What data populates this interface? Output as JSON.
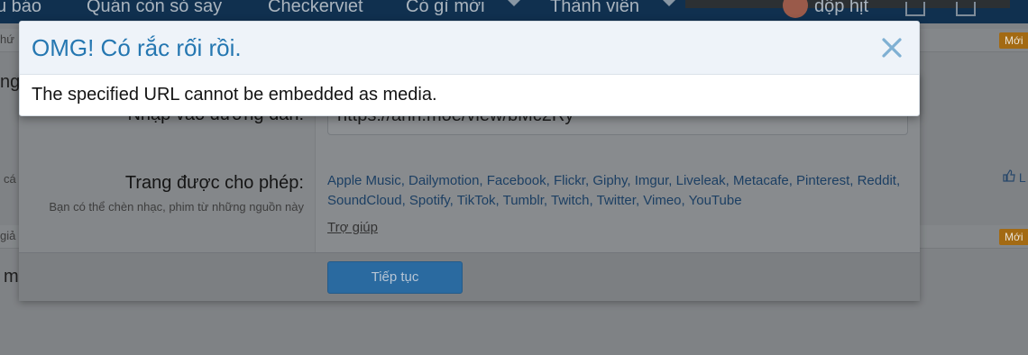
{
  "nav": {
    "items": [
      "u báo",
      "Quán còn sỏ say",
      "Checkerviet",
      "Có gì mới",
      "Thành viên"
    ],
    "user": "dộp hịt"
  },
  "background": {
    "side_texts": [
      "hứ",
      "ng",
      "cá",
      "giả",
      "m"
    ],
    "badges": [
      "Mới",
      "Mới"
    ],
    "like": "L"
  },
  "media_dialog": {
    "url_label": "Nhập vào đường dẫn:",
    "url_value": "https://anh.moe/view/bMc2Ry",
    "sites_label": "Trang được cho phép:",
    "sites_explain": "Bạn có thể chèn nhạc, phim từ những nguồn này",
    "sites": [
      "Apple Music",
      "Dailymotion",
      "Facebook",
      "Flickr",
      "Giphy",
      "Imgur",
      "Liveleak",
      "Metacafe",
      "Pinterest",
      "Reddit",
      "SoundCloud",
      "Spotify",
      "TikTok",
      "Tumblr",
      "Twitch",
      "Twitter",
      "Vimeo",
      "YouTube"
    ],
    "help_link": "Trợ giúp",
    "continue_label": "Tiếp tục"
  },
  "error": {
    "title": "OMG! Có rắc rối rồi.",
    "message": "The specified URL cannot be embedded as media."
  },
  "colors": {
    "title": "#2577b1",
    "close": "#7fb0d3",
    "link": "#2f6aa0",
    "button": "#4a90cf"
  },
  "icons": {
    "close": "close-icon",
    "caret": "chevron-down-icon",
    "like": "thumbs-up-icon"
  }
}
